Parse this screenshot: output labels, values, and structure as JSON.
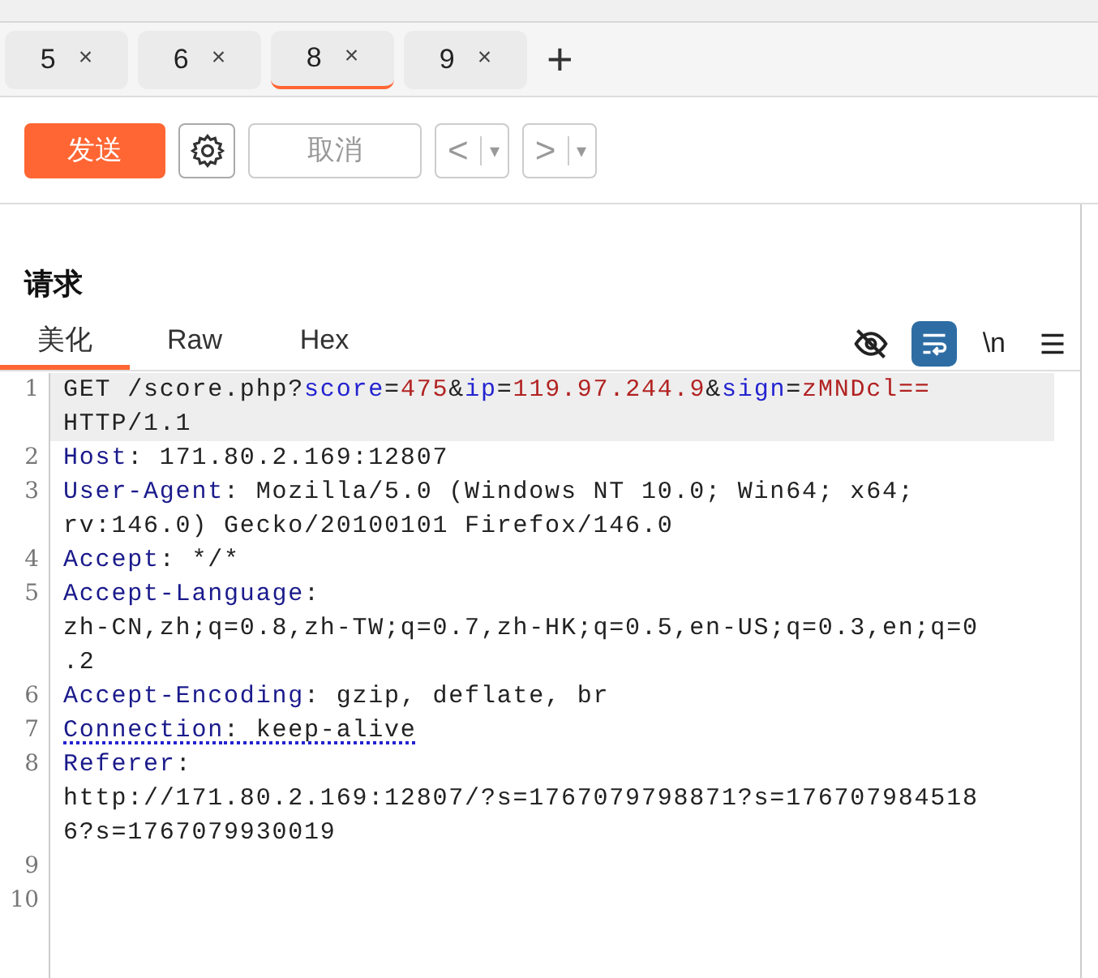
{
  "tabs": [
    {
      "label": "5",
      "close": "×",
      "selected": false
    },
    {
      "label": "6",
      "close": "×",
      "selected": false
    },
    {
      "label": "8",
      "close": "×",
      "selected": true
    },
    {
      "label": "9",
      "close": "×",
      "selected": false
    }
  ],
  "new_tab": "+",
  "toolbar": {
    "send": "发送",
    "cancel": {
      "label": "取消",
      "disabled": true
    },
    "back": {
      "arrow": "<",
      "caret": "▾"
    },
    "forward": {
      "arrow": ">",
      "caret": "▾"
    }
  },
  "request": {
    "title": "请求",
    "view_tabs": [
      {
        "label": "美化",
        "selected": true
      },
      {
        "label": "Raw",
        "selected": false
      },
      {
        "label": "Hex",
        "selected": false
      }
    ],
    "tools": [
      {
        "kind": "hide",
        "on": false
      },
      {
        "kind": "wrap",
        "on": true
      },
      {
        "kind": "newline",
        "label": "\\n",
        "on": false
      },
      {
        "kind": "menu",
        "on": false
      }
    ],
    "lines": [
      {
        "number": "1",
        "selected": true,
        "flagged": false,
        "rows": [
          [
            {
              "kind": "plain",
              "text": "GET /score.php?"
            },
            {
              "kind": "param",
              "text": "score"
            },
            {
              "kind": "plain",
              "text": "="
            },
            {
              "kind": "value",
              "text": "475"
            },
            {
              "kind": "plain",
              "text": "&"
            },
            {
              "kind": "param",
              "text": "ip"
            },
            {
              "kind": "plain",
              "text": "="
            },
            {
              "kind": "value",
              "text": "119.97.244.9"
            },
            {
              "kind": "plain",
              "text": "&"
            },
            {
              "kind": "param",
              "text": "sign"
            },
            {
              "kind": "plain",
              "text": "="
            },
            {
              "kind": "value",
              "text": "zMNDcl=="
            }
          ],
          [
            {
              "kind": "plain",
              "text": "HTTP/1.1"
            }
          ]
        ]
      },
      {
        "number": "2",
        "selected": false,
        "flagged": false,
        "rows": [
          [
            {
              "kind": "header",
              "text": "Host"
            },
            {
              "kind": "plain",
              "text": ": 171.80.2.169:12807"
            }
          ]
        ]
      },
      {
        "number": "3",
        "selected": false,
        "flagged": false,
        "rows": [
          [
            {
              "kind": "header",
              "text": "User-Agent"
            },
            {
              "kind": "plain",
              "text": ": Mozilla/5.0 (Windows NT 10.0; Win64; x64;"
            }
          ],
          [
            {
              "kind": "plain",
              "text": "rv:146.0) Gecko/20100101 Firefox/146.0"
            }
          ]
        ]
      },
      {
        "number": "4",
        "selected": false,
        "flagged": false,
        "rows": [
          [
            {
              "kind": "header",
              "text": "Accept"
            },
            {
              "kind": "plain",
              "text": ": */*"
            }
          ]
        ]
      },
      {
        "number": "5",
        "selected": false,
        "flagged": false,
        "rows": [
          [
            {
              "kind": "header",
              "text": "Accept-Language"
            },
            {
              "kind": "plain",
              "text": ":"
            }
          ],
          [
            {
              "kind": "plain",
              "text": "zh-CN,zh;q=0.8,zh-TW;q=0.7,zh-HK;q=0.5,en-US;q=0.3,en;q=0"
            }
          ],
          [
            {
              "kind": "plain",
              "text": ".2"
            }
          ]
        ]
      },
      {
        "number": "6",
        "selected": false,
        "flagged": false,
        "rows": [
          [
            {
              "kind": "header",
              "text": "Accept-Encoding"
            },
            {
              "kind": "plain",
              "text": ": gzip, deflate, br"
            }
          ]
        ]
      },
      {
        "number": "7",
        "selected": false,
        "flagged": true,
        "rows": [
          [
            {
              "kind": "header",
              "text": "Connection"
            },
            {
              "kind": "plain",
              "text": ": keep-alive"
            }
          ]
        ]
      },
      {
        "number": "8",
        "selected": false,
        "flagged": false,
        "rows": [
          [
            {
              "kind": "header",
              "text": "Referer"
            },
            {
              "kind": "plain",
              "text": ":"
            }
          ],
          [
            {
              "kind": "plain",
              "text": "http://171.80.2.169:12807/?s=1767079798871?s=176707984518"
            }
          ],
          [
            {
              "kind": "plain",
              "text": "6?s=1767079930019"
            }
          ]
        ]
      },
      {
        "number": "9",
        "selected": false
      },
      {
        "number": "10",
        "selected": false
      }
    ]
  }
}
